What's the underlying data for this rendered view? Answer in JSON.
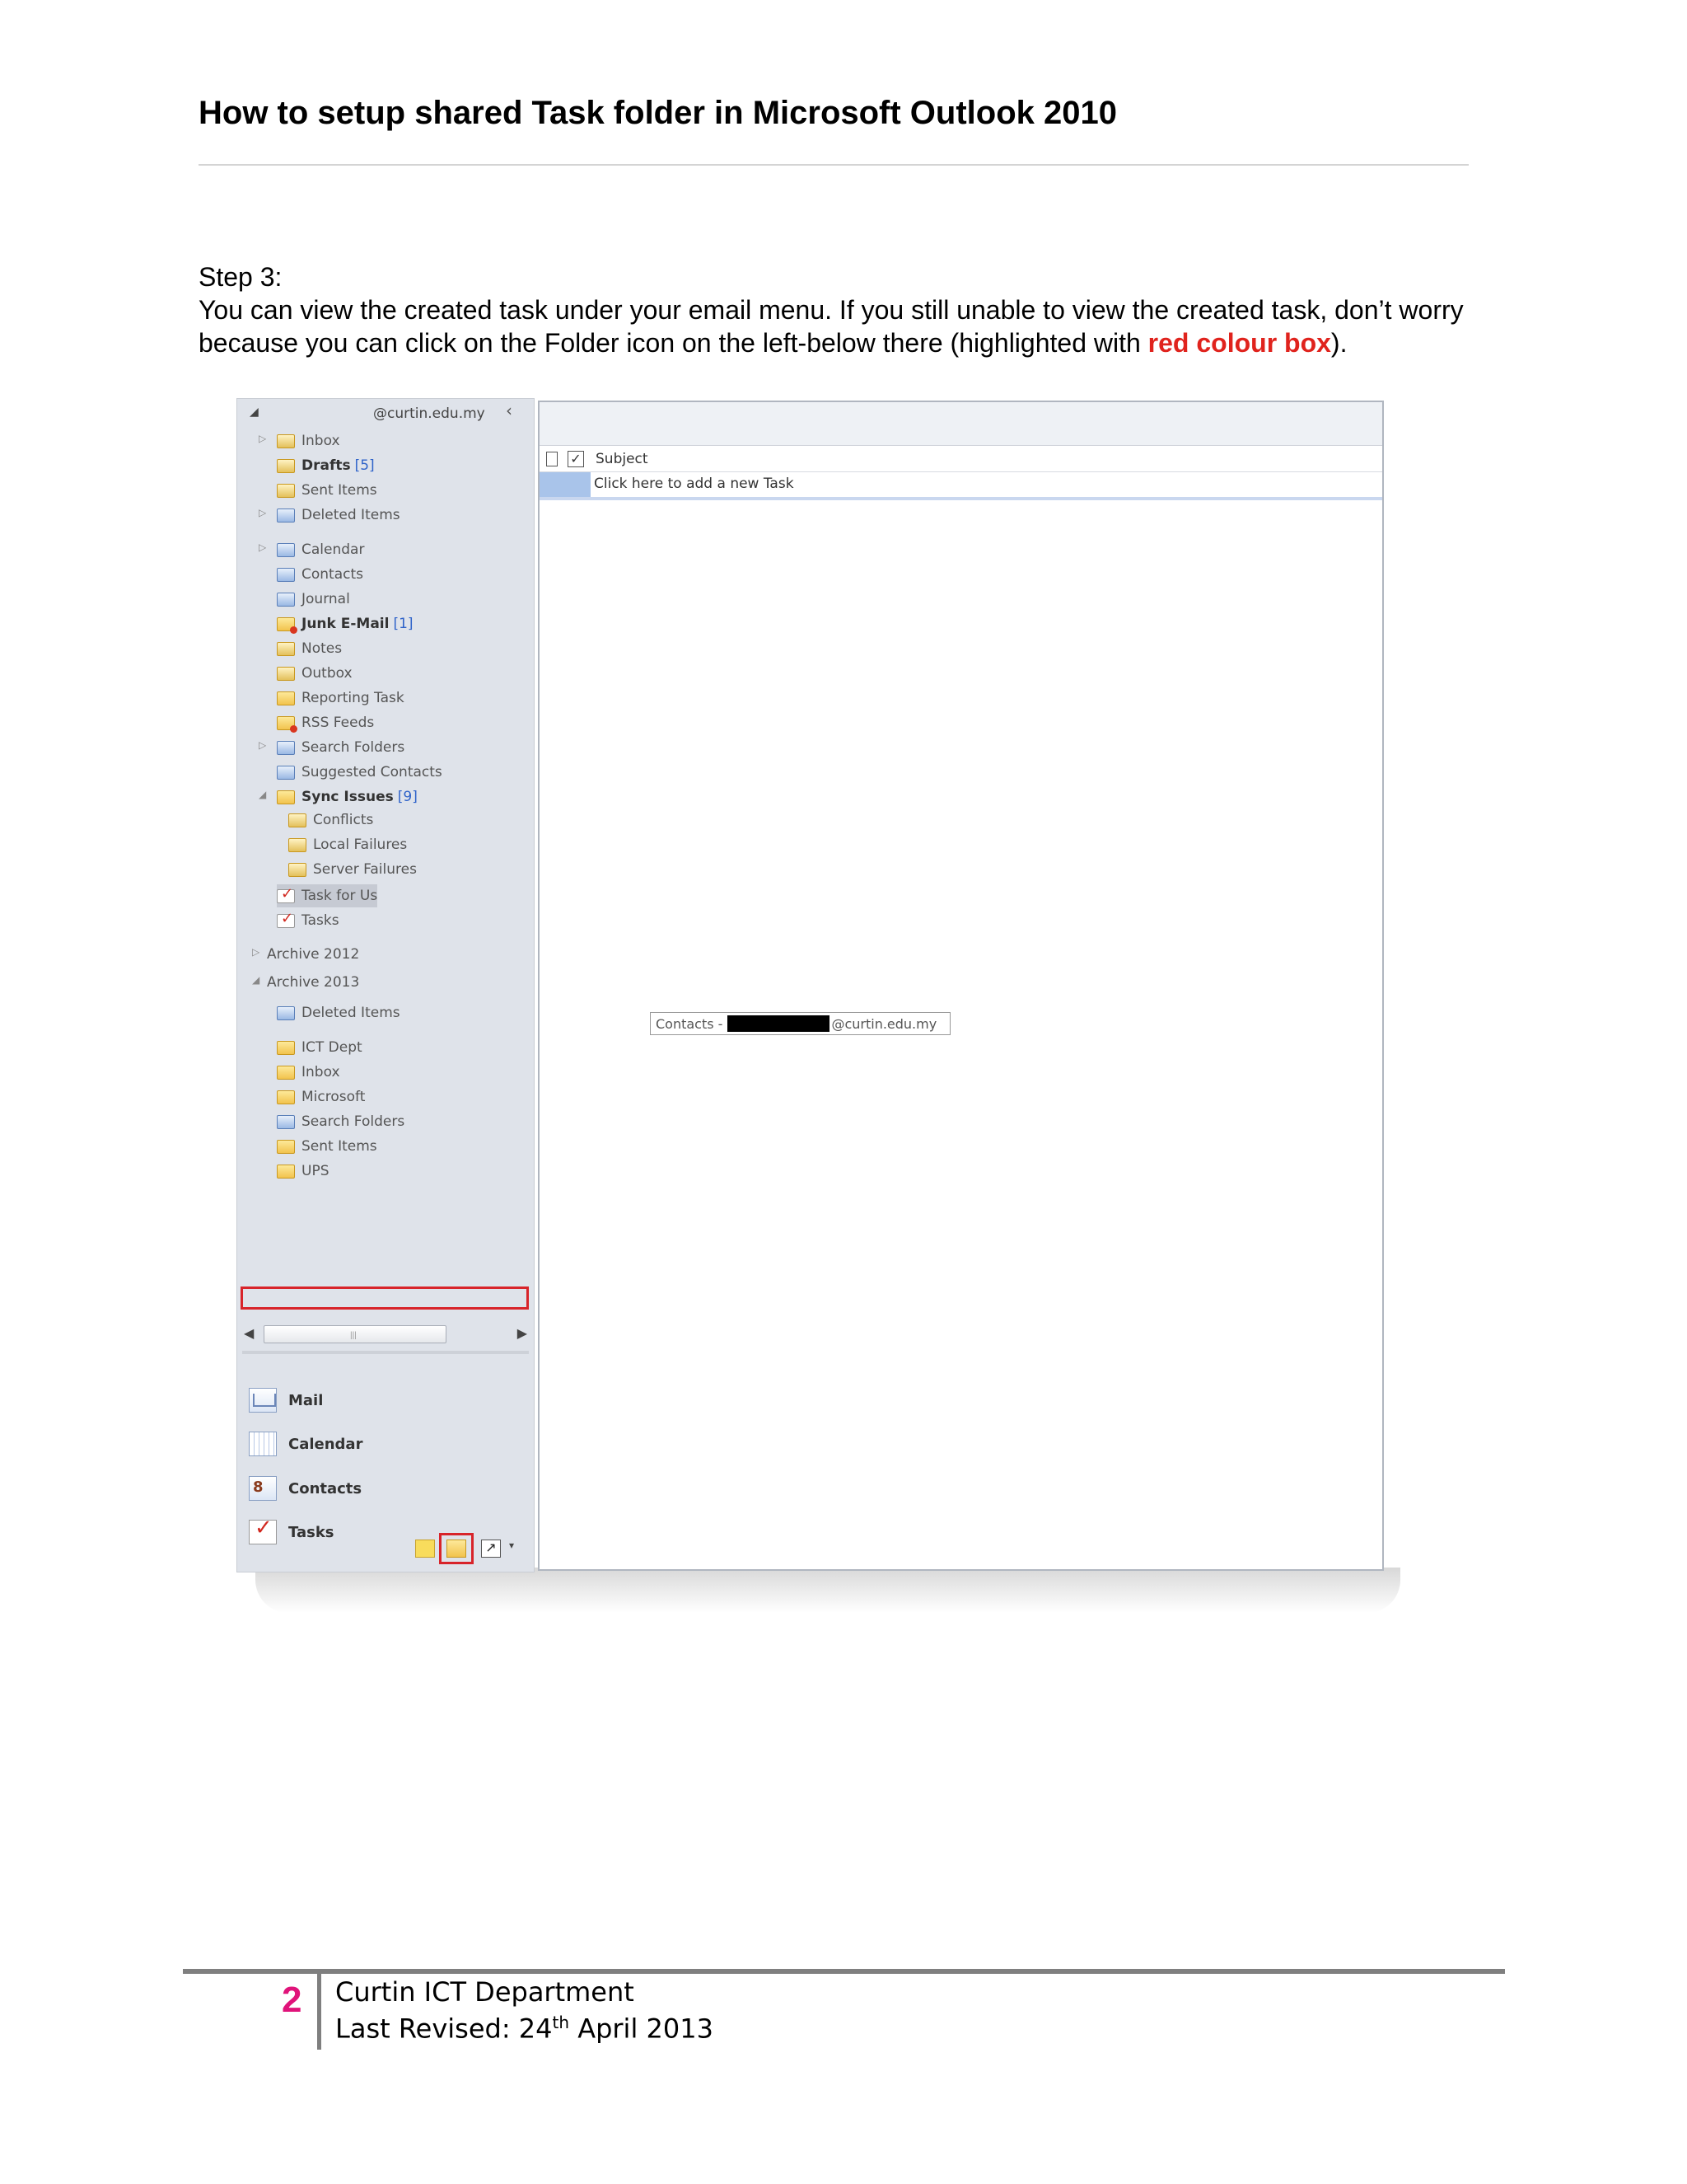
{
  "header": {
    "title": "How to setup shared Task folder in Microsoft Outlook 2010"
  },
  "step": {
    "label": "Step 3:",
    "text_1": "You can view the created task under your email menu. If you still unable to view the created task, don’t worry because you can click on the Folder icon on the left-below there (highlighted with ",
    "highlight": "red colour box",
    "text_2": ")."
  },
  "outlook": {
    "account": "@curtin.edu.my",
    "folders": [
      {
        "label": "Inbox",
        "icon": "inbox-folder-icon"
      },
      {
        "label": "Drafts",
        "count": "[5]",
        "icon": "drafts-folder-icon"
      },
      {
        "label": "Sent Items",
        "icon": "sent-items-folder-icon"
      },
      {
        "label": "Deleted Items",
        "icon": "deleted-items-folder-icon"
      },
      {
        "label": "Calendar",
        "icon": "calendar-folder-icon"
      },
      {
        "label": "Contacts",
        "icon": "contacts-folder-icon"
      },
      {
        "label": "Journal",
        "icon": "journal-folder-icon"
      },
      {
        "label": "Junk E-Mail",
        "count": "[1]",
        "icon": "junk-folder-icon"
      },
      {
        "label": "Notes",
        "icon": "notes-folder-icon"
      },
      {
        "label": "Outbox",
        "icon": "outbox-folder-icon"
      },
      {
        "label": "Reporting Task",
        "icon": "folder-icon"
      },
      {
        "label": "RSS Feeds",
        "icon": "rss-folder-icon"
      },
      {
        "label": "Search Folders",
        "icon": "search-folder-icon"
      },
      {
        "label": "Suggested Contacts",
        "icon": "contacts-folder-icon"
      },
      {
        "label": "Sync Issues",
        "count": "[9]",
        "icon": "folder-icon"
      },
      {
        "label": "Conflicts",
        "icon": "conflicts-folder-icon"
      },
      {
        "label": "Local Failures",
        "icon": "local-failures-folder-icon"
      },
      {
        "label": "Server Failures",
        "icon": "server-failures-folder-icon"
      },
      {
        "label": "Task for Us",
        "icon": "task-folder-icon"
      },
      {
        "label": "Tasks",
        "icon": "task-folder-icon"
      }
    ],
    "archives": [
      {
        "label": "Archive 2012"
      },
      {
        "label": "Archive 2013"
      }
    ],
    "archive_2013_folders": [
      {
        "label": "Deleted Items",
        "icon": "deleted-items-folder-icon"
      },
      {
        "label": "ICT Dept",
        "icon": "folder-icon"
      },
      {
        "label": "Inbox",
        "icon": "folder-icon"
      },
      {
        "label": "Microsoft",
        "icon": "folder-icon"
      },
      {
        "label": "Search Folders",
        "icon": "search-folder-icon"
      },
      {
        "label": "Sent Items",
        "icon": "folder-icon"
      },
      {
        "label": "UPS",
        "icon": "folder-icon"
      }
    ],
    "tooltip": {
      "prefix": "Contacts -",
      "suffix": "@curtin.edu.my"
    },
    "nav_buttons": [
      {
        "label": "Mail",
        "icon": "mail-icon"
      },
      {
        "label": "Calendar",
        "icon": "calendar-icon"
      },
      {
        "label": "Contacts",
        "icon": "contacts-icon"
      },
      {
        "label": "Tasks",
        "icon": "tasks-icon"
      }
    ],
    "task_list": {
      "column_subject": "Subject",
      "new_task_prompt": "Click here to add a new Task"
    }
  },
  "footer": {
    "page_number": "2",
    "department": "Curtin ICT Department",
    "revised_prefix": "Last Revised: 24",
    "revised_sup": "th",
    "revised_suffix": " April 2013"
  },
  "colors": {
    "highlight": "#e0231d",
    "page_number": "#e0137a",
    "red_box": "#d8242a"
  }
}
